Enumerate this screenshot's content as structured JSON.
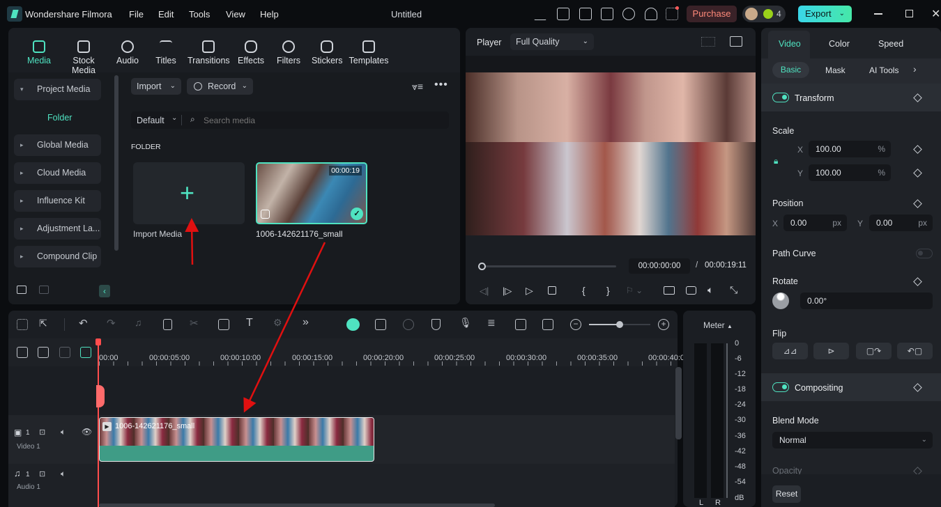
{
  "app": {
    "name": "Wondershare Filmora",
    "title": "Untitled",
    "menu": [
      "File",
      "Edit",
      "Tools",
      "View",
      "Help"
    ],
    "purchase": "Purchase",
    "credits": "4",
    "export": "Export"
  },
  "media_tabs": [
    "Media",
    "Stock Media",
    "Audio",
    "Titles",
    "Transitions",
    "Effects",
    "Filters",
    "Stickers",
    "Templates"
  ],
  "sidebar": {
    "project_media": "Project Media",
    "folder": "Folder",
    "items": [
      "Global Media",
      "Cloud Media",
      "Influence Kit",
      "Adjustment La...",
      "Compound Clip"
    ]
  },
  "library": {
    "import": "Import",
    "record": "Record",
    "sort": "Default",
    "search_placeholder": "Search media",
    "section": "FOLDER",
    "import_media": "Import Media",
    "clip_name": "1006-142621176_small",
    "clip_duration": "00:00:19"
  },
  "player": {
    "label": "Player",
    "quality": "Full Quality",
    "current_time": "00:00:00:00",
    "separator": "/",
    "total_time": "00:00:19:11",
    "progress": 0
  },
  "inspector": {
    "tabs": [
      "Video",
      "Color",
      "Speed"
    ],
    "subtabs": [
      "Basic",
      "Mask",
      "AI Tools"
    ],
    "transform": "Transform",
    "scale": "Scale",
    "scale_x": "100.00",
    "scale_y": "100.00",
    "pct": "%",
    "x": "X",
    "y": "Y",
    "position": "Position",
    "pos_x": "0.00",
    "pos_y": "0.00",
    "px": "px",
    "path_curve": "Path Curve",
    "rotate": "Rotate",
    "rotate_val": "0.00°",
    "flip": "Flip",
    "compositing": "Compositing",
    "blend_mode": "Blend Mode",
    "blend_value": "Normal",
    "opacity": "Opacity",
    "reset": "Reset"
  },
  "timeline": {
    "ruler": [
      "00:00",
      "00:00:05:00",
      "00:00:10:00",
      "00:00:15:00",
      "00:00:20:00",
      "00:00:25:00",
      "00:00:30:00",
      "00:00:35:00",
      "00:00:40:0"
    ],
    "video_track": "Video 1",
    "audio_track": "Audio 1",
    "track_num": "1",
    "clip_label": "1006-142621176_small",
    "zoom_level": 0.7
  },
  "meter": {
    "label": "Meter",
    "scale": [
      "0",
      "-6",
      "-12",
      "-18",
      "-24",
      "-30",
      "-36",
      "-42",
      "-48",
      "-54",
      "dB"
    ],
    "channels": [
      "L",
      "R"
    ]
  },
  "colors": {
    "accent": "#4fe3c1",
    "clip": "#3f9c86",
    "playhead": "#ff4d4d",
    "annotation_arrow": "#e01010"
  }
}
